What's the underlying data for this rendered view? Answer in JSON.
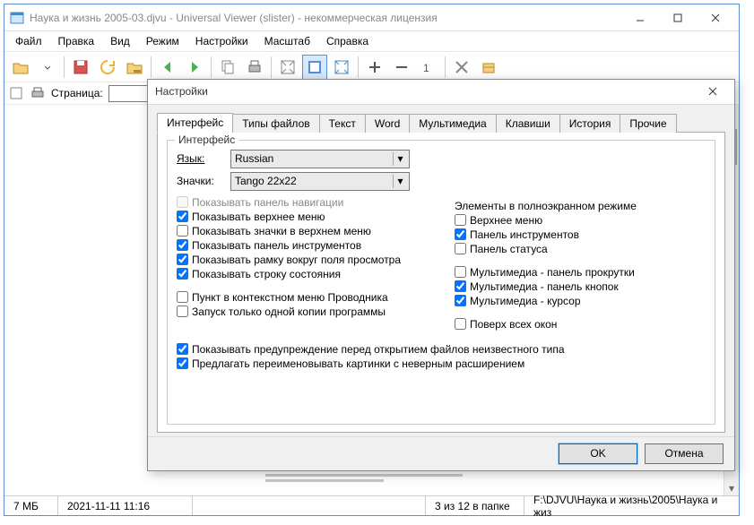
{
  "window": {
    "title": "Наука и жизнь 2005-03.djvu - Universal Viewer (slister) - некоммерческая лицензия"
  },
  "menubar": [
    "Файл",
    "Правка",
    "Вид",
    "Режим",
    "Настройки",
    "Масштаб",
    "Справка"
  ],
  "toolbar2": {
    "page_label": "Страница:",
    "page_value": ""
  },
  "statusbar": {
    "size": "7 МБ",
    "date": "2021-11-11 11:16",
    "pos": "3 из 12 в папке",
    "path": "F:\\DJVU\\Наука и жизнь\\2005\\Наука и жиз"
  },
  "dialog": {
    "title": "Настройки",
    "tabs": [
      "Интерфейс",
      "Типы файлов",
      "Текст",
      "Word",
      "Мультимедиа",
      "Клавиши",
      "История",
      "Прочие"
    ],
    "group_legend": "Интерфейс",
    "lang_label": "Язык:",
    "lang_value": "Russian",
    "icons_label": "Значки:",
    "icons_value": "Tango 22x22",
    "left_checks": [
      {
        "label": "Показывать панель навигации",
        "checked": false,
        "disabled": true
      },
      {
        "label": "Показывать верхнее меню",
        "checked": true
      },
      {
        "label": "Показывать значки в верхнем меню",
        "checked": false
      },
      {
        "label": "Показывать панель инструментов",
        "checked": true
      },
      {
        "label": "Показывать рамку вокруг поля просмотра",
        "checked": true
      },
      {
        "label": "Показывать строку состояния",
        "checked": true
      }
    ],
    "left_checks2": [
      {
        "label": "Пункт в контекстном меню Проводника",
        "checked": false
      },
      {
        "label": "Запуск только одной копии программы",
        "checked": false
      }
    ],
    "right_title": "Элементы в полноэкранном режиме",
    "right_checks": [
      {
        "label": "Верхнее меню",
        "checked": false
      },
      {
        "label": "Панель инструментов",
        "checked": true
      },
      {
        "label": "Панель статуса",
        "checked": false
      }
    ],
    "right_checks2": [
      {
        "label": "Мультимедиа - панель прокрутки",
        "checked": false
      },
      {
        "label": "Мультимедиа - панель кнопок",
        "checked": true
      },
      {
        "label": "Мультимедиа - курсор",
        "checked": true
      }
    ],
    "right_checks3": [
      {
        "label": "Поверх всех окон",
        "checked": false
      }
    ],
    "bottom_checks": [
      {
        "label": "Показывать предупреждение перед открытием файлов неизвестного типа",
        "checked": true
      },
      {
        "label": "Предлагать переименовывать картинки с неверным расширением",
        "checked": true
      }
    ],
    "ok": "OK",
    "cancel": "Отмена"
  }
}
